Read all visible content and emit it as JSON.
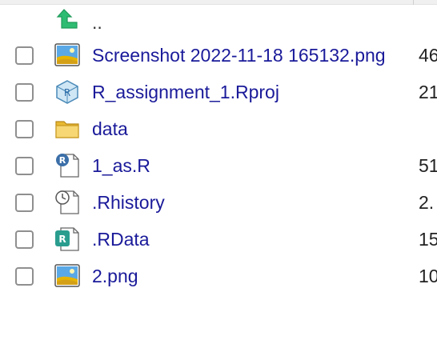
{
  "parent": {
    "label": ".."
  },
  "files": [
    {
      "name": "Screenshot 2022-11-18 165132.png",
      "size": "46",
      "icon": "image-icon"
    },
    {
      "name": "R_assignment_1.Rproj",
      "size": "21",
      "icon": "rproj-icon"
    },
    {
      "name": "data",
      "size": "",
      "icon": "folder-icon"
    },
    {
      "name": "1_as.R",
      "size": "51",
      "icon": "r-script-icon"
    },
    {
      "name": ".Rhistory",
      "size": "2.",
      "icon": "rhistory-icon"
    },
    {
      "name": ".RData",
      "size": "15",
      "icon": "rdata-icon"
    },
    {
      "name": "2.png",
      "size": "10",
      "icon": "image-icon"
    }
  ],
  "colors": {
    "link": "#1a1a9a",
    "folder": "#f2c94c",
    "up_arrow": "#2ebc72"
  }
}
